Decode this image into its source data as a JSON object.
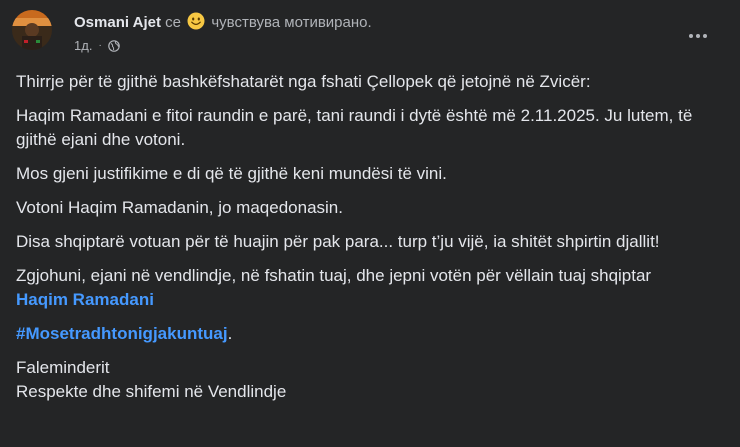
{
  "post": {
    "author": "Osmani Ajet",
    "feeling_prefix": "се",
    "feeling_text": "чувствува мотивирано.",
    "feeling_icon": "smiling-emoji-icon",
    "timestamp": "1д.",
    "audience_icon": "globe-icon",
    "more_icon": "more-options-icon",
    "paragraphs": [
      "Thirrje për të gjithë bashkëfshatarët nga fshati Çellopek që jetojnë në Zvicër:",
      "Haqim Ramadani e fitoi raundin e parë, tani raundi i dytë është më 2.11.2025. Ju lutem, të gjithë ejani dhe votoni.",
      "Mos gjeni justifikime e di që të gjithë keni mundësi të vini.",
      "Votoni Haqim Ramadanin, jo maqedonasin.",
      "Disa shqiptarë votuan për të huajin për pak para... turp t’ju vijë, ia shitët shpirtin djallit!",
      "Zgjohuni, ejani në vendlindje, në fshatin tuaj, dhe jepni votën për vëllain tuaj shqiptar"
    ],
    "mention": "Haqim Ramadani",
    "hashtag": "#Mosetradhtonigjakuntuaj",
    "hashtag_suffix": ".",
    "closing_line_1": "Faleminderit",
    "closing_line_2": "Respekte dhe shifemi në Vendlindje"
  },
  "colors": {
    "background": "#242526",
    "text": "#e4e6eb",
    "secondary_text": "#b0b3b8",
    "link": "#4599ff"
  }
}
